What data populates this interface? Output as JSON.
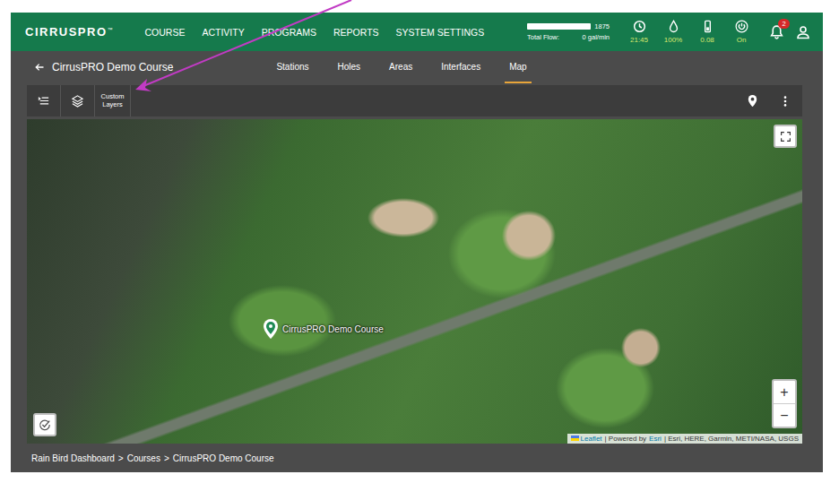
{
  "logo": {
    "text": "CIRRUSPRO",
    "mark": "™"
  },
  "nav": [
    {
      "label": "COURSE"
    },
    {
      "label": "ACTIVITY"
    },
    {
      "label": "PROGRAMS"
    },
    {
      "label": "REPORTS"
    },
    {
      "label": "SYSTEM SETTINGS"
    }
  ],
  "flow": {
    "value": "1875",
    "label": "Total Flow:",
    "reading": "0 gal/min",
    "level": 1
  },
  "status": [
    {
      "kind": "clock",
      "text": "21:45"
    },
    {
      "kind": "drop",
      "text": "100%"
    },
    {
      "kind": "gauge",
      "text": "0.08"
    },
    {
      "kind": "power",
      "text": "On"
    }
  ],
  "notifications": {
    "count": "2"
  },
  "course": {
    "title": "CirrusPRO Demo Course"
  },
  "tabs": [
    {
      "label": "Stations",
      "selected": false
    },
    {
      "label": "Holes",
      "selected": false
    },
    {
      "label": "Areas",
      "selected": false
    },
    {
      "label": "Interfaces",
      "selected": false
    },
    {
      "label": "Map",
      "selected": true
    }
  ],
  "toolbar": {
    "custom_layers": "Custom Layers"
  },
  "map": {
    "pin_label": "CirrusPRO Demo Course",
    "zoom": [
      "+",
      "−"
    ],
    "attribution": [
      {
        "text": "Leaflet",
        "link": true
      },
      {
        "text": "| Powered by",
        "link": false
      },
      {
        "text": "Esri",
        "link": true
      },
      {
        "text": "| Esri, HERE, Garmin, METI/NASA, USGS",
        "link": false
      }
    ]
  },
  "breadcrumb": {
    "separator": ">",
    "items": [
      "Rain Bird Dashboard",
      "Courses",
      "CirrusPRO Demo Course"
    ]
  }
}
